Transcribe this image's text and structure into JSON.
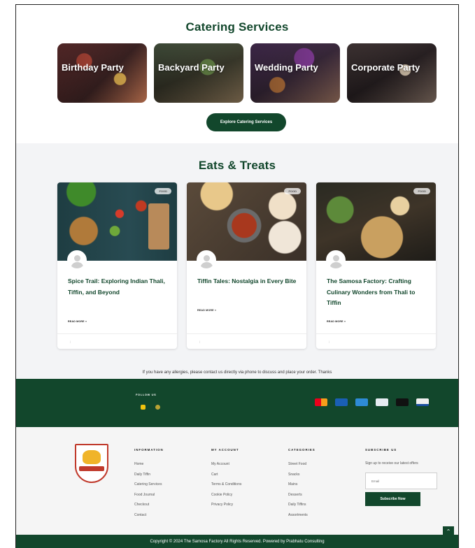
{
  "catering": {
    "title": "Catering Services",
    "cards": [
      {
        "label": "Birthday Party"
      },
      {
        "label": "Backyard Party"
      },
      {
        "label": "Wedding Party"
      },
      {
        "label": "Corporate Party"
      }
    ],
    "button_label": "Explore Catering Services"
  },
  "eats": {
    "title": "Eats & Treats",
    "posts": [
      {
        "tag": "FOOD",
        "title": "Spice Trail: Exploring Indian Thali, Tiffin, and Beyond",
        "read_more": "READ MORE »",
        "date": "",
        "comments": ""
      },
      {
        "tag": "FOOD",
        "title": "Tiffin Tales: Nostalgia in Every Bite",
        "read_more": "READ MORE »",
        "date": "",
        "comments": ""
      },
      {
        "tag": "FOOD",
        "title": "The Samosa Factory: Crafting Culinary Wonders from Thali to Tiffin",
        "read_more": "READ MORE »",
        "date": "",
        "comments": ""
      }
    ],
    "notice": "If you have any allergies, please contact us directly via phone to discuss and place your order. Thanks"
  },
  "band": {
    "follow_label": "FOLLOW US",
    "payment_icons": [
      "mastercard-icon",
      "maestro-icon",
      "amex-icon",
      "generic-card-icon",
      "amazon-pay-icon",
      "visa-icon"
    ]
  },
  "footer": {
    "columns": [
      {
        "heading": "INFORMATION",
        "links": [
          "Home",
          "Daily Tiffin",
          "Catering Services",
          "Food Journal",
          "Checkout",
          "Contact"
        ]
      },
      {
        "heading": "MY ACCOUNT",
        "links": [
          "My Account",
          "Cart",
          "Terms & Conditions",
          "Cookie Policy",
          "Privacy Policy"
        ]
      },
      {
        "heading": "CATEGORIES",
        "links": [
          "Street Food",
          "Snacks",
          "Mains",
          "Desserts",
          "Daily Tiffins",
          "Assortments"
        ]
      }
    ],
    "subscribe": {
      "heading": "SUBSCRIBE US",
      "text": "Sign up to receive our latest offers",
      "email_placeholder": "Email",
      "button_label": "Subscribe Now"
    },
    "back_to_top": "⌃"
  },
  "copyright": "Copyright © 2024 The Samosa Factory All Rights Reserved. Powered by Prabhatu Consulting",
  "colors": {
    "brand_green": "#12472c",
    "accent_yellow": "#f1c40f",
    "logo_red": "#c0392b"
  }
}
